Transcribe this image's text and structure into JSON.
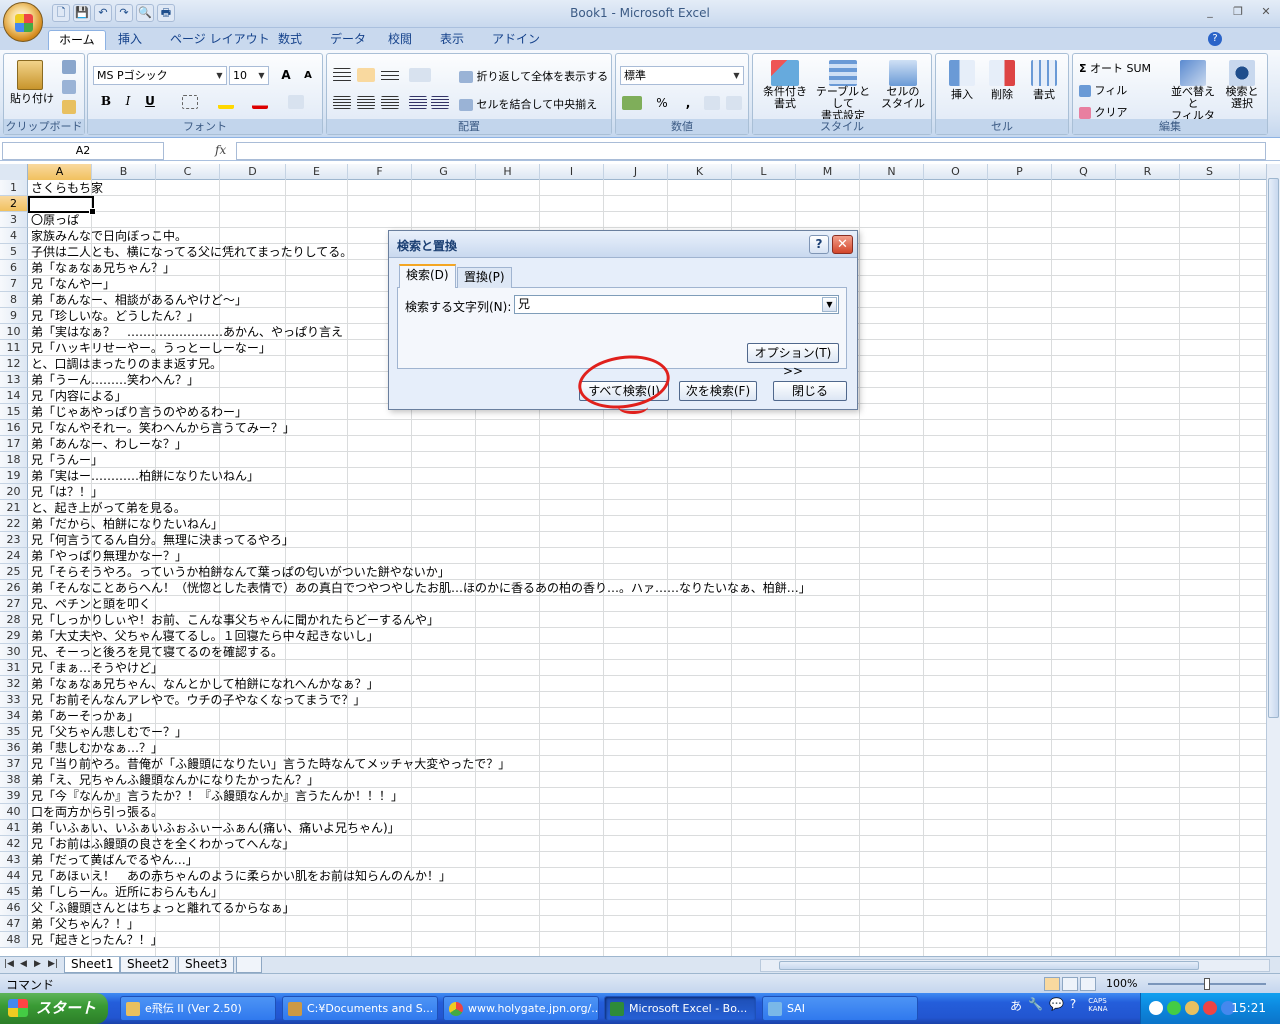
{
  "window": {
    "title": "Book1 - Microsoft Excel",
    "minimize_glyph": "_",
    "restore_glyph": "❐",
    "close_glyph": "✕"
  },
  "quick_access": {
    "icons": [
      "new-icon",
      "save-icon",
      "undo-icon",
      "redo-icon",
      "print-preview-icon",
      "print-icon"
    ],
    "glyphs": [
      "🗋",
      "💾",
      "↶",
      "↷",
      "🔍",
      "🖶"
    ]
  },
  "ribbon_tabs": [
    "ホーム",
    "挿入",
    "ページ レイアウト",
    "数式",
    "データ",
    "校閲",
    "表示",
    "アドイン"
  ],
  "ribbon": {
    "clipboard": {
      "paste": "貼り付け",
      "label": "クリップボード"
    },
    "font": {
      "name": "MS Pゴシック",
      "size": "10",
      "bold": "B",
      "italic": "I",
      "underline": "U",
      "grow": "A",
      "shrink": "A",
      "label": "フォント"
    },
    "alignment": {
      "wrap": "折り返して全体を表示する",
      "merge": "セルを結合して中央揃え",
      "label": "配置"
    },
    "number": {
      "format": "標準",
      "percent": "%",
      "comma": ",",
      "label": "数値"
    },
    "styles": {
      "conditional": "条件付き\n書式",
      "as_table": "テーブルとして\n書式設定",
      "cell_style": "セルの\nスタイル",
      "label": "スタイル"
    },
    "cells": {
      "insert": "挿入",
      "delete": "削除",
      "format": "書式",
      "label": "セル"
    },
    "editing": {
      "autosum": "オート SUM",
      "fill": "フィル",
      "clear": "クリア",
      "sort": "並べ替えと\nフィルタ",
      "find": "検索と\n選択",
      "label": "編集"
    }
  },
  "formula_bar": {
    "name_box": "A2",
    "fx": "fx",
    "content": ""
  },
  "columns": [
    "A",
    "B",
    "C",
    "D",
    "E",
    "F",
    "G",
    "H",
    "I",
    "J",
    "K",
    "L",
    "M",
    "N",
    "O",
    "P",
    "Q",
    "R",
    "S"
  ],
  "selected_cell": {
    "col": "A",
    "row": "2"
  },
  "rows": [
    {
      "n": "1",
      "text": "さくらもち家"
    },
    {
      "n": "2",
      "text": ""
    },
    {
      "n": "3",
      "text": "〇原っぱ"
    },
    {
      "n": "4",
      "text": "家族みんなで日向ぼっこ中。"
    },
    {
      "n": "5",
      "text": "子供は二人とも、横になってる父に凭れてまったりしてる。"
    },
    {
      "n": "6",
      "text": "弟「なぁなぁ兄ちゃん？」"
    },
    {
      "n": "7",
      "text": "兄「なんやー」"
    },
    {
      "n": "8",
      "text": "弟「あんなー、相談があるんやけど～」"
    },
    {
      "n": "9",
      "text": "兄「珍しいな。どうしたん？」"
    },
    {
      "n": "10",
      "text": "弟「実はなぁ？　……………………あかん、やっぱり言え"
    },
    {
      "n": "11",
      "text": "兄「ハッキリせーやー。うっとーしーなー」"
    },
    {
      "n": "12",
      "text": "と、口調はまったりのまま返す兄。"
    },
    {
      "n": "13",
      "text": "弟「うーん………笑わへん？」"
    },
    {
      "n": "14",
      "text": "兄「内容による」"
    },
    {
      "n": "15",
      "text": "弟「じゃあやっぱり言うのやめるわー」"
    },
    {
      "n": "16",
      "text": "兄「なんやそれー。笑わへんから言うてみー？」"
    },
    {
      "n": "17",
      "text": "弟「あんなー、わしーな？」"
    },
    {
      "n": "18",
      "text": "兄「うんー」"
    },
    {
      "n": "19",
      "text": "弟「実はー…………柏餅になりたいねん」"
    },
    {
      "n": "20",
      "text": "兄「は？！」"
    },
    {
      "n": "21",
      "text": "と、起き上がって弟を見る。"
    },
    {
      "n": "22",
      "text": "弟「だから、柏餅になりたいねん」"
    },
    {
      "n": "23",
      "text": "兄「何言うてるん自分。無理に決まってるやろ」"
    },
    {
      "n": "24",
      "text": "弟「やっぱり無理かなー？」"
    },
    {
      "n": "25",
      "text": "兄「そらそうやろ。っていうか柏餅なんて葉っぱの匂いがついた餅やないか」"
    },
    {
      "n": "26",
      "text": "弟「そんなことあらへん！（恍惚とした表情で）あの真白でつやつやしたお肌…ほのかに香るあの柏の香り…。ハァ……なりたいなぁ、柏餅…」"
    },
    {
      "n": "27",
      "text": "兄、ペチンと頭を叩く"
    },
    {
      "n": "28",
      "text": "兄「しっかりしぃや！お前、こんな事父ちゃんに聞かれたらどーするんや」"
    },
    {
      "n": "29",
      "text": "弟「大丈夫や、父ちゃん寝てるし。１回寝たら中々起きないし」"
    },
    {
      "n": "30",
      "text": "兄、そーっと後ろを見て寝てるのを確認する。"
    },
    {
      "n": "31",
      "text": "兄「まぁ…そうやけど」"
    },
    {
      "n": "32",
      "text": "弟「なぁなぁ兄ちゃん、なんとかして柏餅になれへんかなぁ？」"
    },
    {
      "n": "33",
      "text": "兄「お前そんなんアレやで。ウチの子やなくなってまうで？」"
    },
    {
      "n": "34",
      "text": "弟「あーそっかぁ」"
    },
    {
      "n": "35",
      "text": "兄「父ちゃん悲しむでー？」"
    },
    {
      "n": "36",
      "text": "弟「悲しむかなぁ…？」"
    },
    {
      "n": "37",
      "text": "兄「当り前やろ。昔俺が「ふ饅頭になりたい」言うた時なんてメッチャ大変やったで？」"
    },
    {
      "n": "38",
      "text": "弟「え、兄ちゃんふ饅頭なんかになりたかったん？」"
    },
    {
      "n": "39",
      "text": "兄「今『なんか』言うたか？！『ふ饅頭なんか』言うたんか！！！」"
    },
    {
      "n": "40",
      "text": "口を両方から引っ張る。"
    },
    {
      "n": "41",
      "text": "弟「いふぁい、いふぁいふぉふぃーふぁん(痛い、痛いよ兄ちゃん)」"
    },
    {
      "n": "42",
      "text": "兄「お前はふ饅頭の良さを全くわかってへんな」"
    },
    {
      "n": "43",
      "text": "弟「だって黄ばんでるやん…」"
    },
    {
      "n": "44",
      "text": "兄「あほぃえ！　あの赤ちゃんのように柔らかい肌をお前は知らんのんか！」"
    },
    {
      "n": "45",
      "text": "弟「しらーん。近所におらんもん」"
    },
    {
      "n": "46",
      "text": "父「ふ饅頭さんとはちょっと離れてるからなぁ」"
    },
    {
      "n": "47",
      "text": "弟「父ちゃん？！」"
    },
    {
      "n": "48",
      "text": "兄「起きとったん？！」"
    }
  ],
  "sheets": [
    "Sheet1",
    "Sheet2",
    "Sheet3"
  ],
  "status": {
    "text": "コマンド",
    "zoom": "100%"
  },
  "dialog": {
    "title": "検索と置換",
    "help": "?",
    "close": "✕",
    "tabs": [
      "検索(D)",
      "置換(P)"
    ],
    "find_label": "検索する文字列(N):",
    "find_value": "兄",
    "options": "オプション(T) >>",
    "find_all": "すべて検索(I)",
    "find_next": "次を検索(F)",
    "close_btn": "閉じる"
  },
  "taskbar": {
    "start": "スタート",
    "tasks": [
      "e飛伝 II (Ver 2.50)",
      "C:¥Documents and S...",
      "www.holygate.jpn.org/...",
      "Microsoft Excel - Bo...",
      "SAI"
    ],
    "ime": [
      "あ",
      "🔧",
      "💬",
      "?"
    ],
    "caps": "CAPS",
    "kana": "KANA",
    "clock": "15:21"
  }
}
